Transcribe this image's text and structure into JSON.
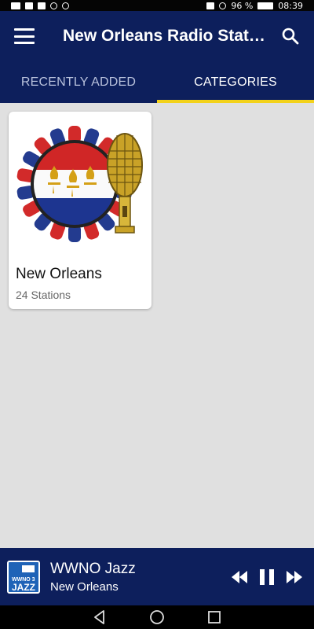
{
  "status_bar": {
    "battery_percent": "96 %",
    "time": "08:39"
  },
  "app_bar": {
    "title": "New Orleans Radio Stati…",
    "tabs": [
      {
        "label": "RECENTLY ADDED",
        "active": false
      },
      {
        "label": "CATEGORIES",
        "active": true
      }
    ],
    "indicator_color": "#f3d21b",
    "background_color": "#0d1f5c"
  },
  "categories": [
    {
      "name": "New Orleans",
      "station_count": "24 Stations"
    }
  ],
  "player": {
    "station": "WWNO Jazz",
    "location": "New Orleans",
    "logo_text": "JAZZ",
    "logo_subtext": "WWNO 3"
  }
}
